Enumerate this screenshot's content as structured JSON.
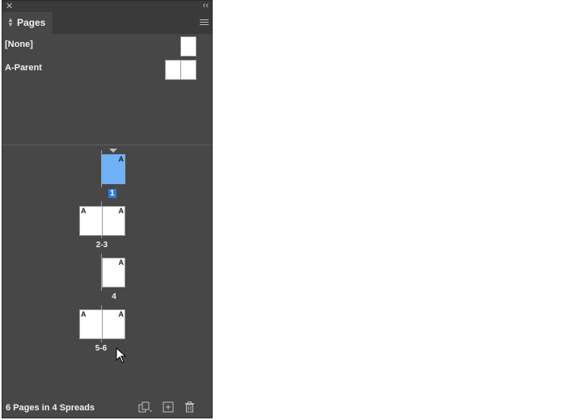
{
  "panel": {
    "title": "Pages",
    "parents": [
      {
        "label": "[None]"
      },
      {
        "label": "A-Parent"
      }
    ],
    "spreads": [
      {
        "label": "1",
        "left": "",
        "right": "A",
        "selected": true
      },
      {
        "label": "2-3",
        "left": "A",
        "right": "A",
        "selected": false
      },
      {
        "label": "4",
        "left": "",
        "right": "A",
        "selected": false
      },
      {
        "label": "5-6",
        "left": "A",
        "right": "A",
        "selected": false
      }
    ],
    "footer": {
      "status": "6 Pages in 4 Spreads"
    },
    "icons": {
      "close": "close-icon",
      "collapse": "collapse-icon",
      "menu": "panel-menu-icon",
      "edit_page_size": "edit-page-size-icon",
      "new_page": "new-page-icon",
      "delete": "trash-icon"
    }
  }
}
